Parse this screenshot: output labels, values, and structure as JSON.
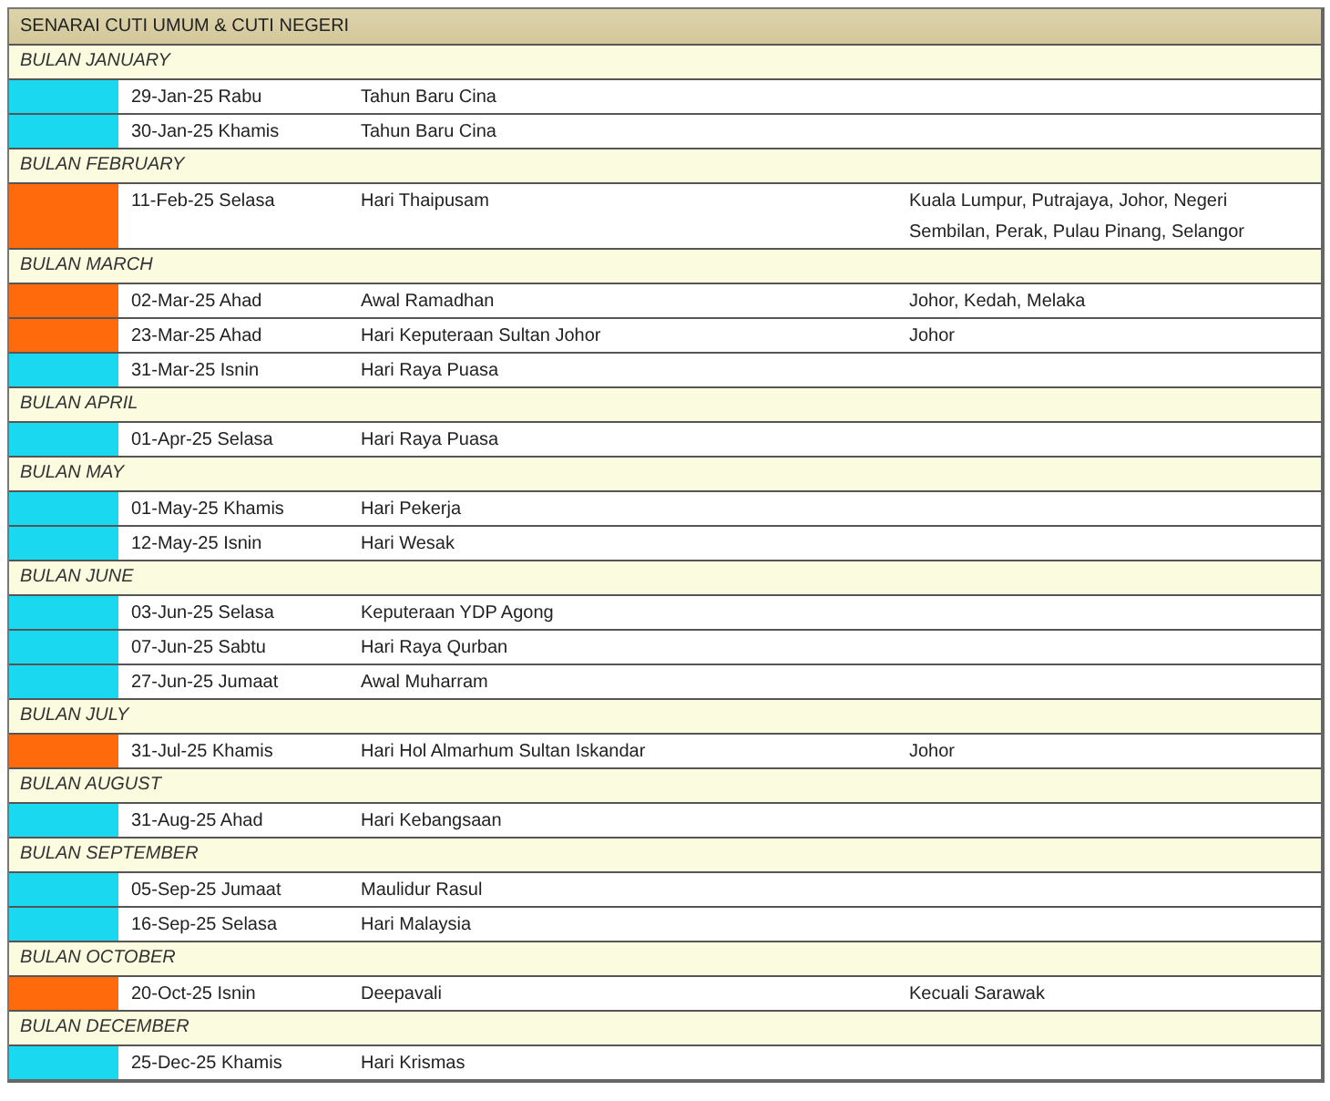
{
  "title": "SENARAI CUTI UMUM & CUTI NEGERI",
  "months": [
    {
      "label": "BULAN JANUARY",
      "holidays": [
        {
          "color": "#1ad8f0",
          "date": "29-Jan-25 Rabu",
          "name": "Tahun Baru Cina"
        },
        {
          "color": "#1ad8f0",
          "date": "30-Jan-25 Khamis",
          "name": "Tahun Baru Cina"
        }
      ]
    },
    {
      "label": "BULAN FEBRUARY",
      "holidays": [
        {
          "color": "#ff6a0d",
          "date": "11-Feb-25 Selasa",
          "name": "Hari Thaipusam",
          "states": "Kuala Lumpur, Putrajaya, Johor, Negeri Sembilan, Perak, Pulau Pinang, Selangor"
        }
      ]
    },
    {
      "label": "BULAN MARCH",
      "holidays": [
        {
          "color": "#ff6a0d",
          "date": "02-Mar-25 Ahad",
          "name": "Awal Ramadhan",
          "states": "Johor, Kedah, Melaka"
        },
        {
          "color": "#ff6a0d",
          "date": "23-Mar-25 Ahad",
          "name": "Hari Keputeraan Sultan Johor",
          "states": "Johor"
        },
        {
          "color": "#1ad8f0",
          "date": "31-Mar-25 Isnin",
          "name": "Hari Raya Puasa"
        }
      ]
    },
    {
      "label": "BULAN APRIL",
      "holidays": [
        {
          "color": "#1ad8f0",
          "date": "01-Apr-25 Selasa",
          "name": "Hari Raya Puasa"
        }
      ]
    },
    {
      "label": "BULAN MAY",
      "holidays": [
        {
          "color": "#1ad8f0",
          "date": "01-May-25 Khamis",
          "name": "Hari Pekerja"
        },
        {
          "color": "#1ad8f0",
          "date": "12-May-25 Isnin",
          "name": "Hari Wesak"
        }
      ]
    },
    {
      "label": "BULAN JUNE",
      "holidays": [
        {
          "color": "#1ad8f0",
          "date": "03-Jun-25 Selasa",
          "name": "Keputeraan YDP Agong"
        },
        {
          "color": "#1ad8f0",
          "date": "07-Jun-25 Sabtu",
          "name": "Hari Raya Qurban"
        },
        {
          "color": "#1ad8f0",
          "date": "27-Jun-25 Jumaat",
          "name": "Awal Muharram"
        }
      ]
    },
    {
      "label": "BULAN JULY",
      "holidays": [
        {
          "color": "#ff6a0d",
          "date": "31-Jul-25 Khamis",
          "name": "Hari Hol Almarhum Sultan Iskandar",
          "states": "Johor"
        }
      ]
    },
    {
      "label": "BULAN AUGUST",
      "holidays": [
        {
          "color": "#1ad8f0",
          "date": "31-Aug-25 Ahad",
          "name": "Hari Kebangsaan"
        }
      ]
    },
    {
      "label": "BULAN SEPTEMBER",
      "holidays": [
        {
          "color": "#1ad8f0",
          "date": "05-Sep-25 Jumaat",
          "name": "Maulidur Rasul"
        },
        {
          "color": "#1ad8f0",
          "date": "16-Sep-25 Selasa",
          "name": "Hari Malaysia"
        }
      ]
    },
    {
      "label": "BULAN OCTOBER",
      "holidays": [
        {
          "color": "#ff6a0d",
          "date": "20-Oct-25 Isnin",
          "name": "Deepavali",
          "states": "Kecuali Sarawak"
        }
      ]
    },
    {
      "label": "BULAN DECEMBER",
      "holidays": [
        {
          "color": "#1ad8f0",
          "date": "25-Dec-25 Khamis",
          "name": "Hari Krismas"
        }
      ]
    }
  ]
}
